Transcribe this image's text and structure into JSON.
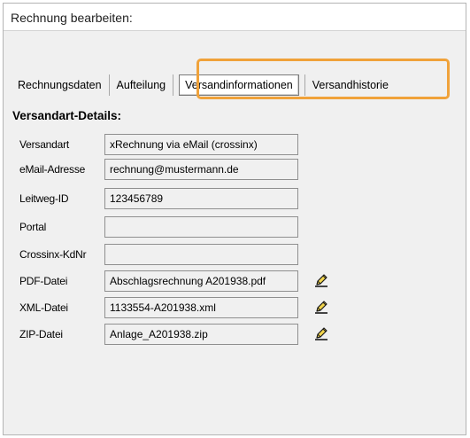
{
  "window": {
    "title": "Rechnung bearbeiten:"
  },
  "tabs": [
    {
      "label": "Rechnungsdaten",
      "active": false
    },
    {
      "label": "Aufteilung",
      "active": false
    },
    {
      "label": "Versandinformationen",
      "active": true
    },
    {
      "label": "Versandhistorie",
      "active": false
    }
  ],
  "highlight_color": "#f0a23a",
  "section": {
    "heading": "Versandart-Details:"
  },
  "fields": [
    {
      "label": "Versandart",
      "value": "xRechnung via eMail (crossinx)",
      "editable": false
    },
    {
      "label": "eMail-Adresse",
      "value": "rechnung@mustermann.de",
      "editable": false
    },
    {
      "label": "Leitweg-ID",
      "value": "123456789",
      "editable": false
    },
    {
      "label": "Portal",
      "value": "",
      "editable": false
    },
    {
      "label": "Crossinx-KdNr",
      "value": "",
      "editable": false
    },
    {
      "label": "PDF-Datei",
      "value": "Abschlagsrechnung A201938.pdf",
      "editable": true,
      "icon": "edit-pencil-icon"
    },
    {
      "label": "XML-Datei",
      "value": "1133554-A201938.xml",
      "editable": true,
      "icon": "edit-pencil-icon"
    },
    {
      "label": "ZIP-Datei",
      "value": "Anlage_A201938.zip",
      "editable": true,
      "icon": "edit-pencil-icon"
    }
  ]
}
